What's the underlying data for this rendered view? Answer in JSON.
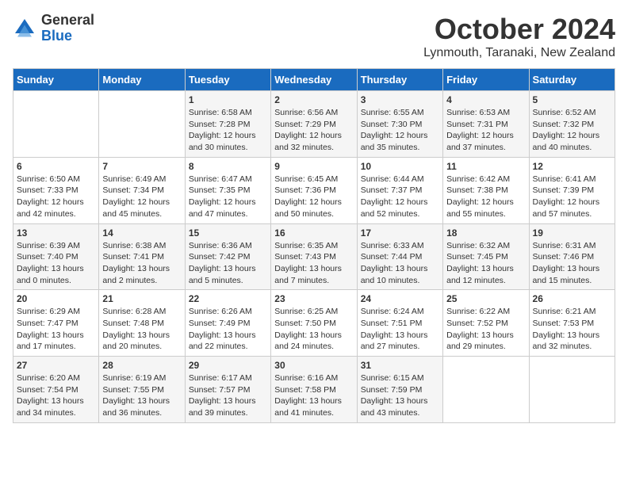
{
  "logo": {
    "general": "General",
    "blue": "Blue"
  },
  "header": {
    "month": "October 2024",
    "location": "Lynmouth, Taranaki, New Zealand"
  },
  "weekdays": [
    "Sunday",
    "Monday",
    "Tuesday",
    "Wednesday",
    "Thursday",
    "Friday",
    "Saturday"
  ],
  "weeks": [
    [
      {
        "day": "",
        "sunrise": "",
        "sunset": "",
        "daylight": ""
      },
      {
        "day": "",
        "sunrise": "",
        "sunset": "",
        "daylight": ""
      },
      {
        "day": "1",
        "sunrise": "Sunrise: 6:58 AM",
        "sunset": "Sunset: 7:28 PM",
        "daylight": "Daylight: 12 hours and 30 minutes."
      },
      {
        "day": "2",
        "sunrise": "Sunrise: 6:56 AM",
        "sunset": "Sunset: 7:29 PM",
        "daylight": "Daylight: 12 hours and 32 minutes."
      },
      {
        "day": "3",
        "sunrise": "Sunrise: 6:55 AM",
        "sunset": "Sunset: 7:30 PM",
        "daylight": "Daylight: 12 hours and 35 minutes."
      },
      {
        "day": "4",
        "sunrise": "Sunrise: 6:53 AM",
        "sunset": "Sunset: 7:31 PM",
        "daylight": "Daylight: 12 hours and 37 minutes."
      },
      {
        "day": "5",
        "sunrise": "Sunrise: 6:52 AM",
        "sunset": "Sunset: 7:32 PM",
        "daylight": "Daylight: 12 hours and 40 minutes."
      }
    ],
    [
      {
        "day": "6",
        "sunrise": "Sunrise: 6:50 AM",
        "sunset": "Sunset: 7:33 PM",
        "daylight": "Daylight: 12 hours and 42 minutes."
      },
      {
        "day": "7",
        "sunrise": "Sunrise: 6:49 AM",
        "sunset": "Sunset: 7:34 PM",
        "daylight": "Daylight: 12 hours and 45 minutes."
      },
      {
        "day": "8",
        "sunrise": "Sunrise: 6:47 AM",
        "sunset": "Sunset: 7:35 PM",
        "daylight": "Daylight: 12 hours and 47 minutes."
      },
      {
        "day": "9",
        "sunrise": "Sunrise: 6:45 AM",
        "sunset": "Sunset: 7:36 PM",
        "daylight": "Daylight: 12 hours and 50 minutes."
      },
      {
        "day": "10",
        "sunrise": "Sunrise: 6:44 AM",
        "sunset": "Sunset: 7:37 PM",
        "daylight": "Daylight: 12 hours and 52 minutes."
      },
      {
        "day": "11",
        "sunrise": "Sunrise: 6:42 AM",
        "sunset": "Sunset: 7:38 PM",
        "daylight": "Daylight: 12 hours and 55 minutes."
      },
      {
        "day": "12",
        "sunrise": "Sunrise: 6:41 AM",
        "sunset": "Sunset: 7:39 PM",
        "daylight": "Daylight: 12 hours and 57 minutes."
      }
    ],
    [
      {
        "day": "13",
        "sunrise": "Sunrise: 6:39 AM",
        "sunset": "Sunset: 7:40 PM",
        "daylight": "Daylight: 13 hours and 0 minutes."
      },
      {
        "day": "14",
        "sunrise": "Sunrise: 6:38 AM",
        "sunset": "Sunset: 7:41 PM",
        "daylight": "Daylight: 13 hours and 2 minutes."
      },
      {
        "day": "15",
        "sunrise": "Sunrise: 6:36 AM",
        "sunset": "Sunset: 7:42 PM",
        "daylight": "Daylight: 13 hours and 5 minutes."
      },
      {
        "day": "16",
        "sunrise": "Sunrise: 6:35 AM",
        "sunset": "Sunset: 7:43 PM",
        "daylight": "Daylight: 13 hours and 7 minutes."
      },
      {
        "day": "17",
        "sunrise": "Sunrise: 6:33 AM",
        "sunset": "Sunset: 7:44 PM",
        "daylight": "Daylight: 13 hours and 10 minutes."
      },
      {
        "day": "18",
        "sunrise": "Sunrise: 6:32 AM",
        "sunset": "Sunset: 7:45 PM",
        "daylight": "Daylight: 13 hours and 12 minutes."
      },
      {
        "day": "19",
        "sunrise": "Sunrise: 6:31 AM",
        "sunset": "Sunset: 7:46 PM",
        "daylight": "Daylight: 13 hours and 15 minutes."
      }
    ],
    [
      {
        "day": "20",
        "sunrise": "Sunrise: 6:29 AM",
        "sunset": "Sunset: 7:47 PM",
        "daylight": "Daylight: 13 hours and 17 minutes."
      },
      {
        "day": "21",
        "sunrise": "Sunrise: 6:28 AM",
        "sunset": "Sunset: 7:48 PM",
        "daylight": "Daylight: 13 hours and 20 minutes."
      },
      {
        "day": "22",
        "sunrise": "Sunrise: 6:26 AM",
        "sunset": "Sunset: 7:49 PM",
        "daylight": "Daylight: 13 hours and 22 minutes."
      },
      {
        "day": "23",
        "sunrise": "Sunrise: 6:25 AM",
        "sunset": "Sunset: 7:50 PM",
        "daylight": "Daylight: 13 hours and 24 minutes."
      },
      {
        "day": "24",
        "sunrise": "Sunrise: 6:24 AM",
        "sunset": "Sunset: 7:51 PM",
        "daylight": "Daylight: 13 hours and 27 minutes."
      },
      {
        "day": "25",
        "sunrise": "Sunrise: 6:22 AM",
        "sunset": "Sunset: 7:52 PM",
        "daylight": "Daylight: 13 hours and 29 minutes."
      },
      {
        "day": "26",
        "sunrise": "Sunrise: 6:21 AM",
        "sunset": "Sunset: 7:53 PM",
        "daylight": "Daylight: 13 hours and 32 minutes."
      }
    ],
    [
      {
        "day": "27",
        "sunrise": "Sunrise: 6:20 AM",
        "sunset": "Sunset: 7:54 PM",
        "daylight": "Daylight: 13 hours and 34 minutes."
      },
      {
        "day": "28",
        "sunrise": "Sunrise: 6:19 AM",
        "sunset": "Sunset: 7:55 PM",
        "daylight": "Daylight: 13 hours and 36 minutes."
      },
      {
        "day": "29",
        "sunrise": "Sunrise: 6:17 AM",
        "sunset": "Sunset: 7:57 PM",
        "daylight": "Daylight: 13 hours and 39 minutes."
      },
      {
        "day": "30",
        "sunrise": "Sunrise: 6:16 AM",
        "sunset": "Sunset: 7:58 PM",
        "daylight": "Daylight: 13 hours and 41 minutes."
      },
      {
        "day": "31",
        "sunrise": "Sunrise: 6:15 AM",
        "sunset": "Sunset: 7:59 PM",
        "daylight": "Daylight: 13 hours and 43 minutes."
      },
      {
        "day": "",
        "sunrise": "",
        "sunset": "",
        "daylight": ""
      },
      {
        "day": "",
        "sunrise": "",
        "sunset": "",
        "daylight": ""
      }
    ]
  ]
}
